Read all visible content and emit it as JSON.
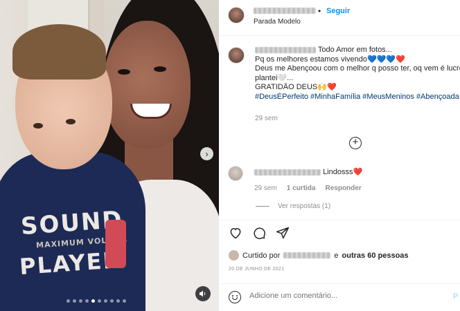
{
  "header": {
    "follow_label": "Seguir",
    "separator": "•",
    "location": "Parada Modelo"
  },
  "caption": {
    "line1": "Todo Amor em fotos...",
    "line2": "Pq os melhores estamos vivendo",
    "line2_emoji": "💙💙💙",
    "line2_heart": "❤️",
    "line3": "Deus me Abençoou com o melhor q posso ter, oq vem é lucro!!",
    "line4": "plantei🤍...",
    "line5": "GRATIDÃO DEUS🙌",
    "line5_heart": "❤️",
    "hashtags": "#DeusÉPerfeito #MinhaFamília #MeusMeninos #Abençoada",
    "time": "29 sem"
  },
  "comment": {
    "text": "Lindosss",
    "heart": "❤️",
    "time": "29 sem",
    "likes": "1 curtida",
    "reply": "Responder",
    "view_replies": "Ver respostas (1)"
  },
  "likes": {
    "prefix": "Curtido por",
    "middle": "e",
    "others": "outras 60 pessoas"
  },
  "date": "20 DE JUNHO DE 2021",
  "comment_bar": {
    "placeholder": "Adicione um comentário...",
    "publish": "P"
  },
  "photo": {
    "shirt_top": "SOUND",
    "shirt_mid": "MAXIMUM VOLUME",
    "shirt_bottom": "PLAYER",
    "next_arrow": "›",
    "sound_icon": "speaker-icon"
  },
  "icons": [
    "heart-icon",
    "comment-icon",
    "share-icon",
    "plus-circle-icon",
    "emoji-icon"
  ]
}
